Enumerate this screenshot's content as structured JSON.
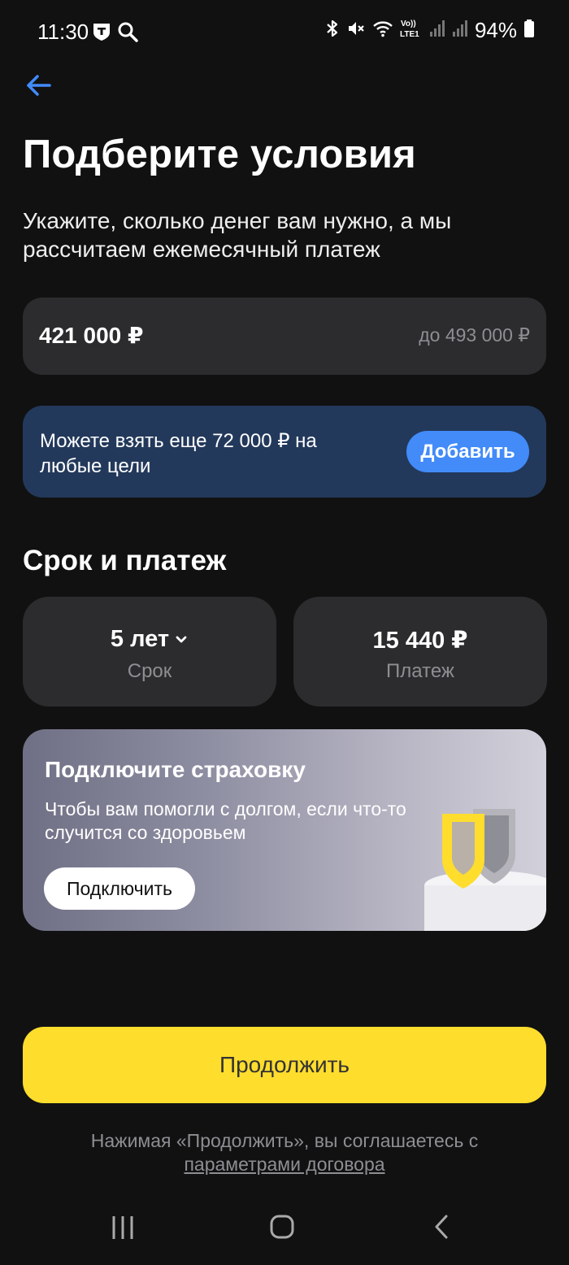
{
  "status_bar": {
    "time": "11:30",
    "battery": "94%",
    "icons_left": [
      "tinkoff-notification-icon",
      "search-icon"
    ],
    "icons_right": [
      "bluetooth-icon",
      "mute-icon",
      "wifi-icon",
      "volte-icon",
      "signal-icon",
      "signal-icon",
      "battery-icon"
    ],
    "volte_label": "Vo)) LTE1"
  },
  "header": {
    "back_icon": "arrow-left-icon",
    "title": "Подберите условия",
    "subtitle": "Укажите, сколько денег вам нужно, а мы рассчитаем ежемесячный платеж"
  },
  "amount": {
    "value": "421 000 ₽",
    "limit": "до 493 000 ₽"
  },
  "offer": {
    "text": "Можете взять еще 72 000 ₽ на любые цели",
    "button": "Добавить"
  },
  "terms_section": {
    "title": "Срок и платеж",
    "term": {
      "value": "5 лет",
      "label": "Срок",
      "icon": "chevron-down-icon"
    },
    "payment": {
      "value": "15 440 ₽",
      "label": "Платеж"
    }
  },
  "insurance": {
    "title": "Подключите страховку",
    "text": "Чтобы вам помогли с долгом, если что-то случится со здоровьем",
    "button": "Подключить",
    "illustration": "shield-icon"
  },
  "footer": {
    "continue": "Продолжить",
    "agreement_prefix": "Нажимая «Продолжить», вы соглашаетесь с ",
    "agreement_link": "параметрами договора"
  },
  "colors": {
    "background": "#111112",
    "card": "#2c2c2e",
    "offer_bg": "#23395b",
    "accent_blue": "#428bf9",
    "accent_yellow": "#ffdd2d",
    "muted_text": "#8e8e93"
  }
}
